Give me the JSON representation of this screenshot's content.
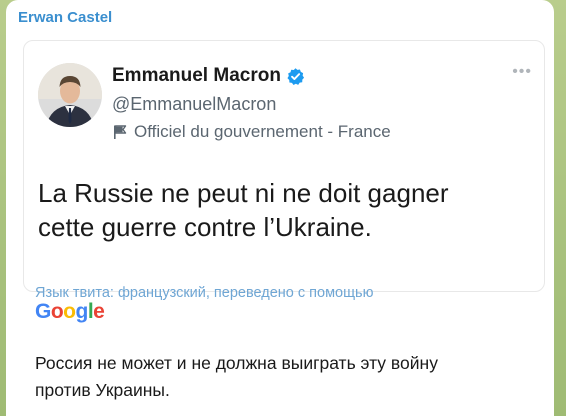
{
  "message": {
    "channel_name": "Erwan Castel"
  },
  "tweet": {
    "display_name": "Emmanuel Macron",
    "verified_icon": "verified-badge-icon",
    "handle": "@EmmanuelMacron",
    "official_label": "Officiel du gouvernement - France",
    "more_icon": "more-options-icon",
    "text_line1": "La Russie ne peut ni ne doit gagner",
    "text_line2": "cette guerre contre l’Ukraine."
  },
  "translation": {
    "note": "Язык твита: французский, переведено с помощью",
    "provider_letters": [
      "G",
      "o",
      "o",
      "g",
      "l",
      "e"
    ],
    "text_line1": "Россия не может и не должна выиграть эту войну",
    "text_line2": "против Украины."
  },
  "colors": {
    "channel_name": "#3b8fcf",
    "verified_badge": "#1d9bf0",
    "translate_note": "#6fa6d4",
    "background": "#b9cd8c"
  }
}
